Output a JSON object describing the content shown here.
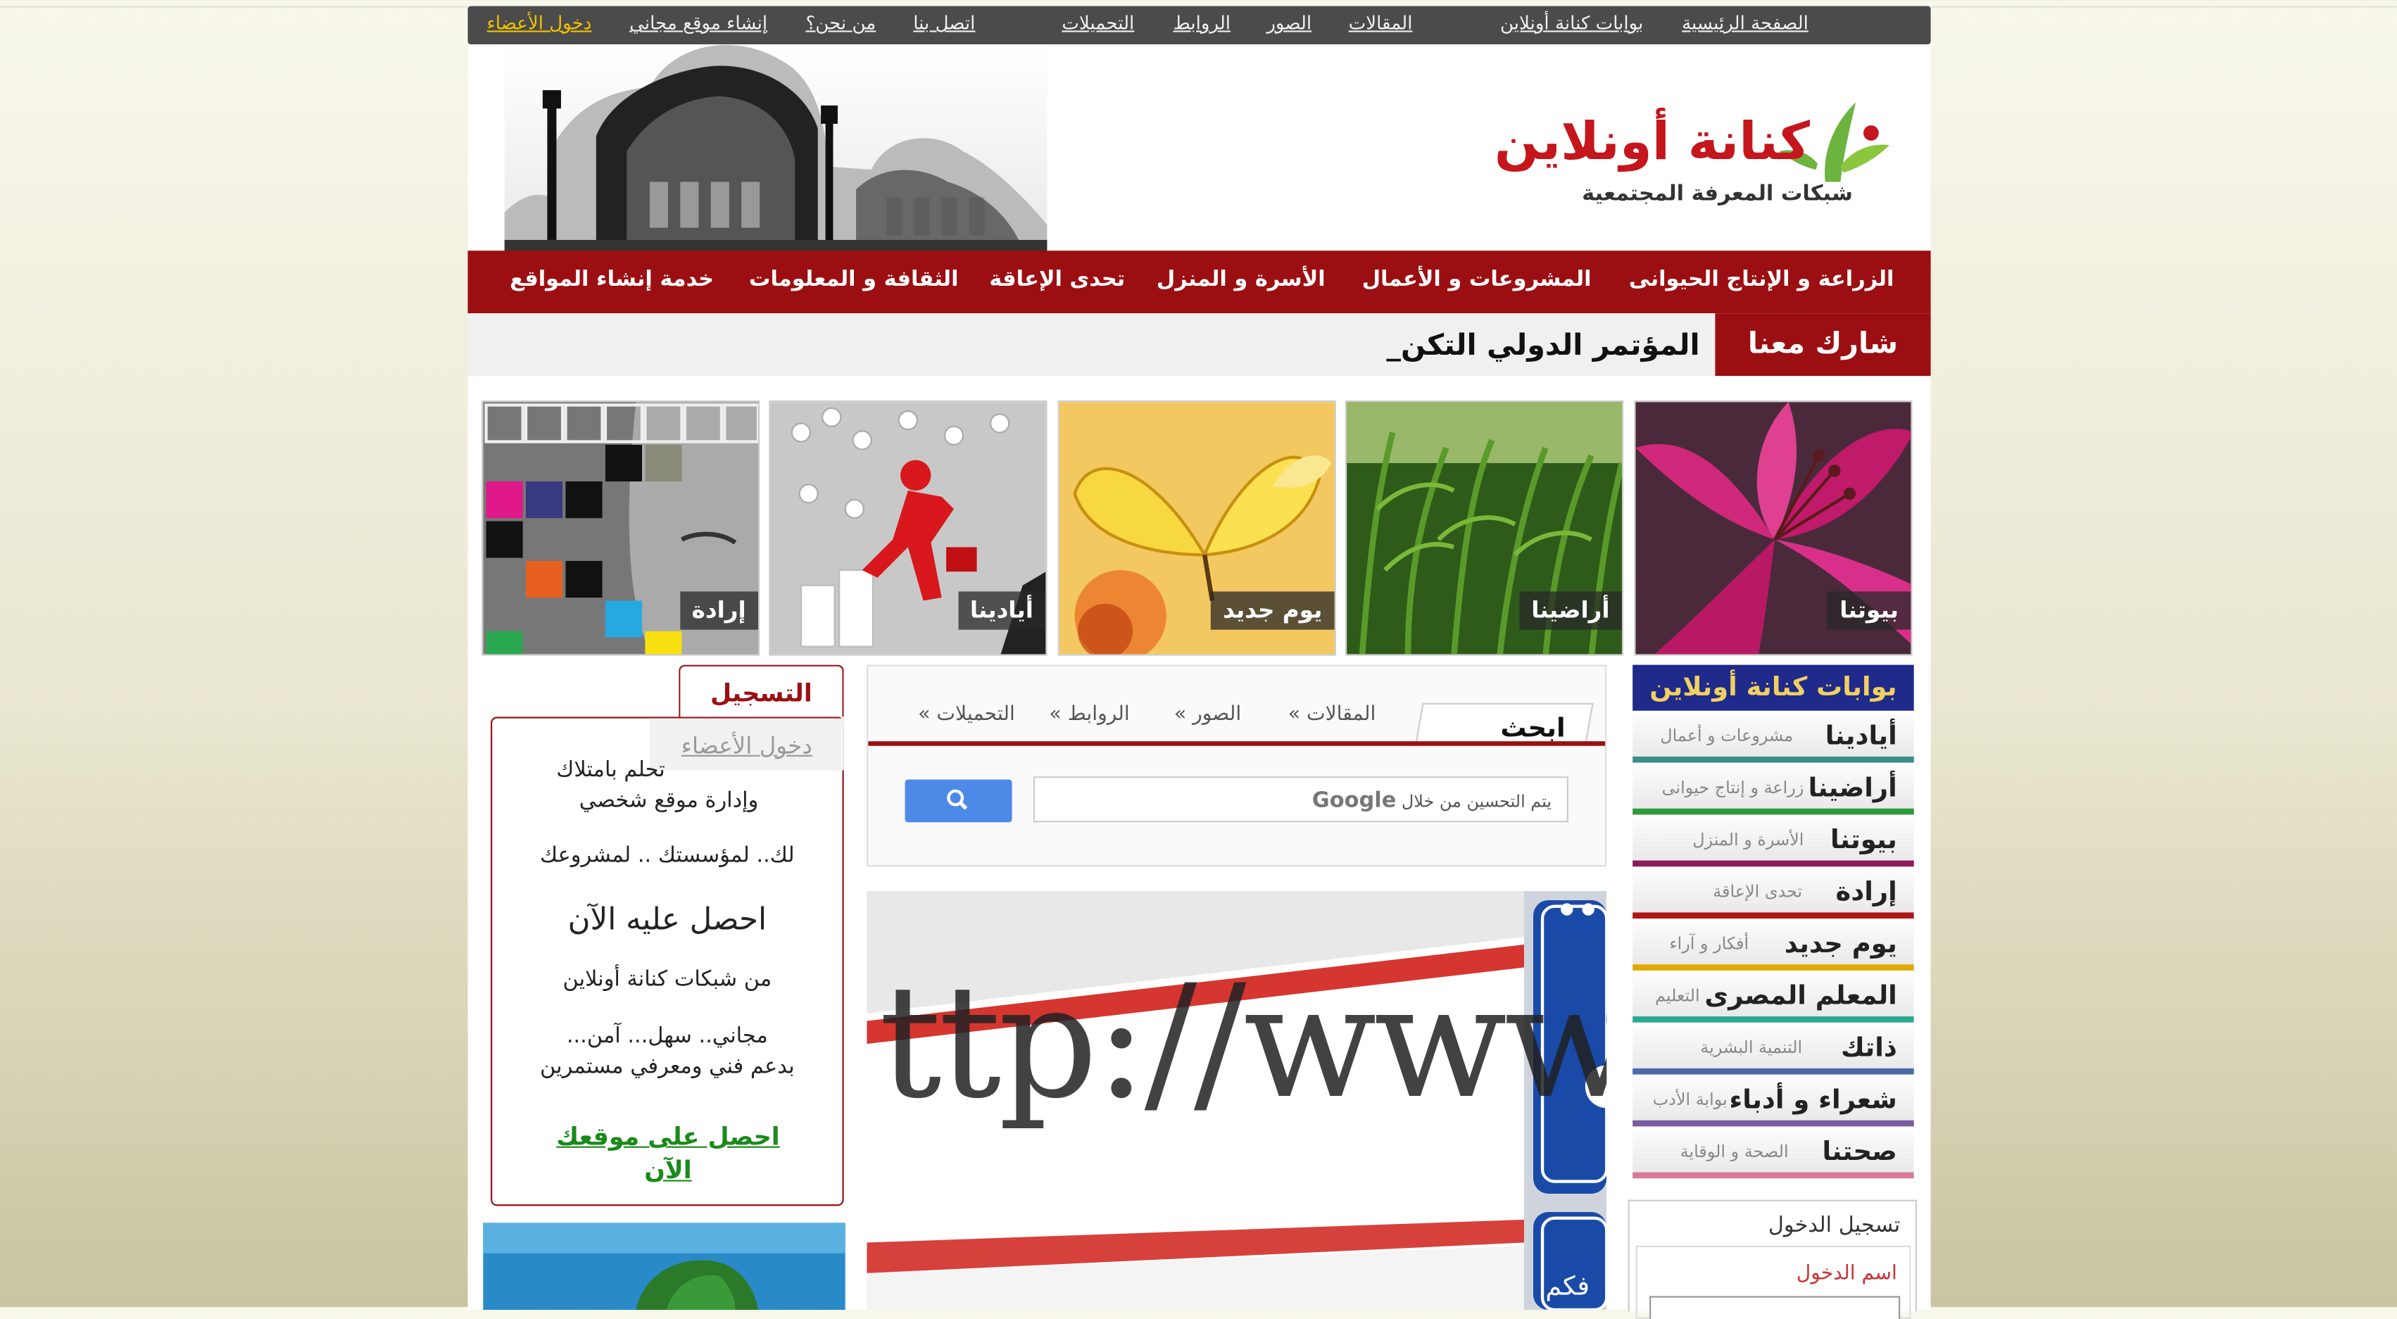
{
  "topbar": {
    "links": [
      "الصفحة الرئيسية",
      "بوابات كنانة أونلاين",
      "المقالات",
      "الصور",
      "الروابط",
      "التحميلات",
      "اتصل بنا",
      "من نحن؟",
      "إنشاء موقع مجاني",
      "دخول الأعضاء"
    ]
  },
  "header": {
    "logo_title": "كنانة أونلاين",
    "logo_subtitle": "شبكات المعرفة المجتمعية"
  },
  "main_nav": [
    "الزراعة و الإنتاج الحيوانى",
    "المشروعات و الأعمال",
    "الأسرة و المنزل",
    "تحدى الإعاقة",
    "الثقافة و المعلومات",
    "خدمة إنشاء المواقع"
  ],
  "ticker": {
    "share_label": "شارك معنا",
    "headline": "المؤتمر الدولي التكن_"
  },
  "tiles": [
    "بيوتنا",
    "أراضينا",
    "يوم جديد",
    "أيادينا",
    "إرادة"
  ],
  "portals": {
    "title": "بوابات كنانة أونلاين",
    "items": [
      {
        "name": "أيادينا",
        "sub": "مشروعات و أعمال",
        "color": "#3a8f8a"
      },
      {
        "name": "أراضينا",
        "sub": "زراعة و إنتاج حيوانى",
        "color": "#2f9a3a"
      },
      {
        "name": "بيوتنا",
        "sub": "الأسرة و المنزل",
        "color": "#8a1a5a"
      },
      {
        "name": "إرادة",
        "sub": "تحدى الإعاقة",
        "color": "#b01818"
      },
      {
        "name": "يوم جديد",
        "sub": "أفكار و آراء",
        "color": "#e0a800"
      },
      {
        "name": "المعلم المصرى",
        "sub": "التعليم",
        "color": "#2aa890"
      },
      {
        "name": "ذاتك",
        "sub": "التنمية البشرية",
        "color": "#4a6aa8"
      },
      {
        "name": "شعراء و أدباء",
        "sub": "بوابة الأدب",
        "color": "#7a5aa0"
      },
      {
        "name": "صحتنا",
        "sub": "الصحة و الوقاية",
        "color": "#d87a9a"
      }
    ]
  },
  "login": {
    "title": "تسجيل الدخول",
    "username_label": "اسم الدخول"
  },
  "search": {
    "active_tab": "ابحث",
    "tabs": [
      "المقالات »",
      "الصور »",
      "الروابط »",
      "التحميلات »"
    ],
    "hint": "يتم التحسين من خلال",
    "google": "Google"
  },
  "register": {
    "tab_register": "التسجيل",
    "tab_login": "دخول الأعضاء",
    "line1": "تحلم بامتلاك",
    "line2": "وإدارة موقع شخصي",
    "line3": "لك.. لمؤسستك .. لمشروعك",
    "line4": "احصل عليه الآن",
    "line5": "من شبكات كنانة أونلاين",
    "line6": "مجاني.. سهل... آمن...",
    "line7": "بدعم فني ومعرفي مستمرين",
    "cta_1": "احصل على موقعك",
    "cta_2": "الآن"
  },
  "banner": {
    "url_text": "ttp://www",
    "side_text": "فكم"
  }
}
